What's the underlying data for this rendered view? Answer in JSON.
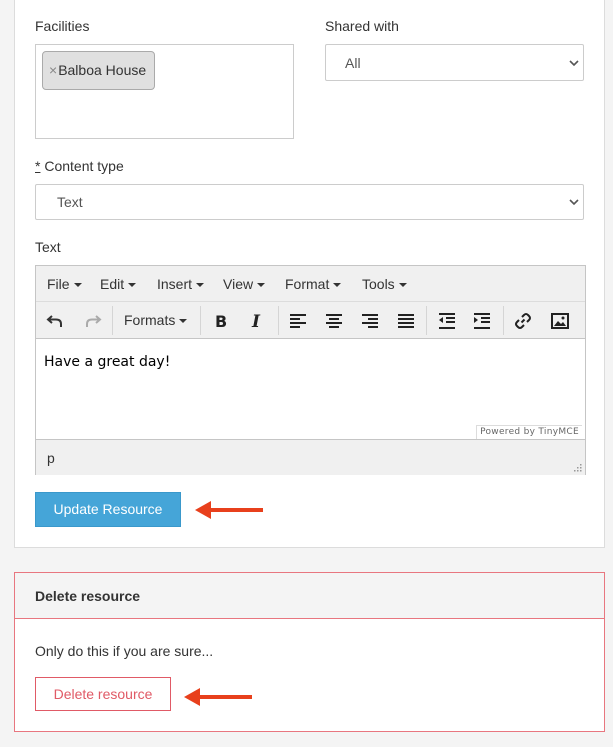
{
  "form": {
    "facilities_label": "Facilities",
    "facilities_tag_remove": "×",
    "facilities_tag": "Balboa House",
    "shared_with_label": "Shared with",
    "shared_with_value": "All",
    "content_type_required": "*",
    "content_type_label": " Content type",
    "content_type_value": "Text",
    "text_label": "Text"
  },
  "editor": {
    "menu": [
      "File",
      "Edit",
      "Insert",
      "View",
      "Format",
      "Tools"
    ],
    "formats_label": "Formats",
    "content": "Have a great day!",
    "powered_by": "Powered by TinyMCE",
    "status_path": "p"
  },
  "update_button": "Update Resource",
  "delete_panel": {
    "title": "Delete resource",
    "note": "Only do this if you are sure...",
    "button": "Delete resource"
  },
  "colors": {
    "primary": "#45a5d8",
    "danger": "#e05a66",
    "annotation_arrow": "#e8401c"
  }
}
